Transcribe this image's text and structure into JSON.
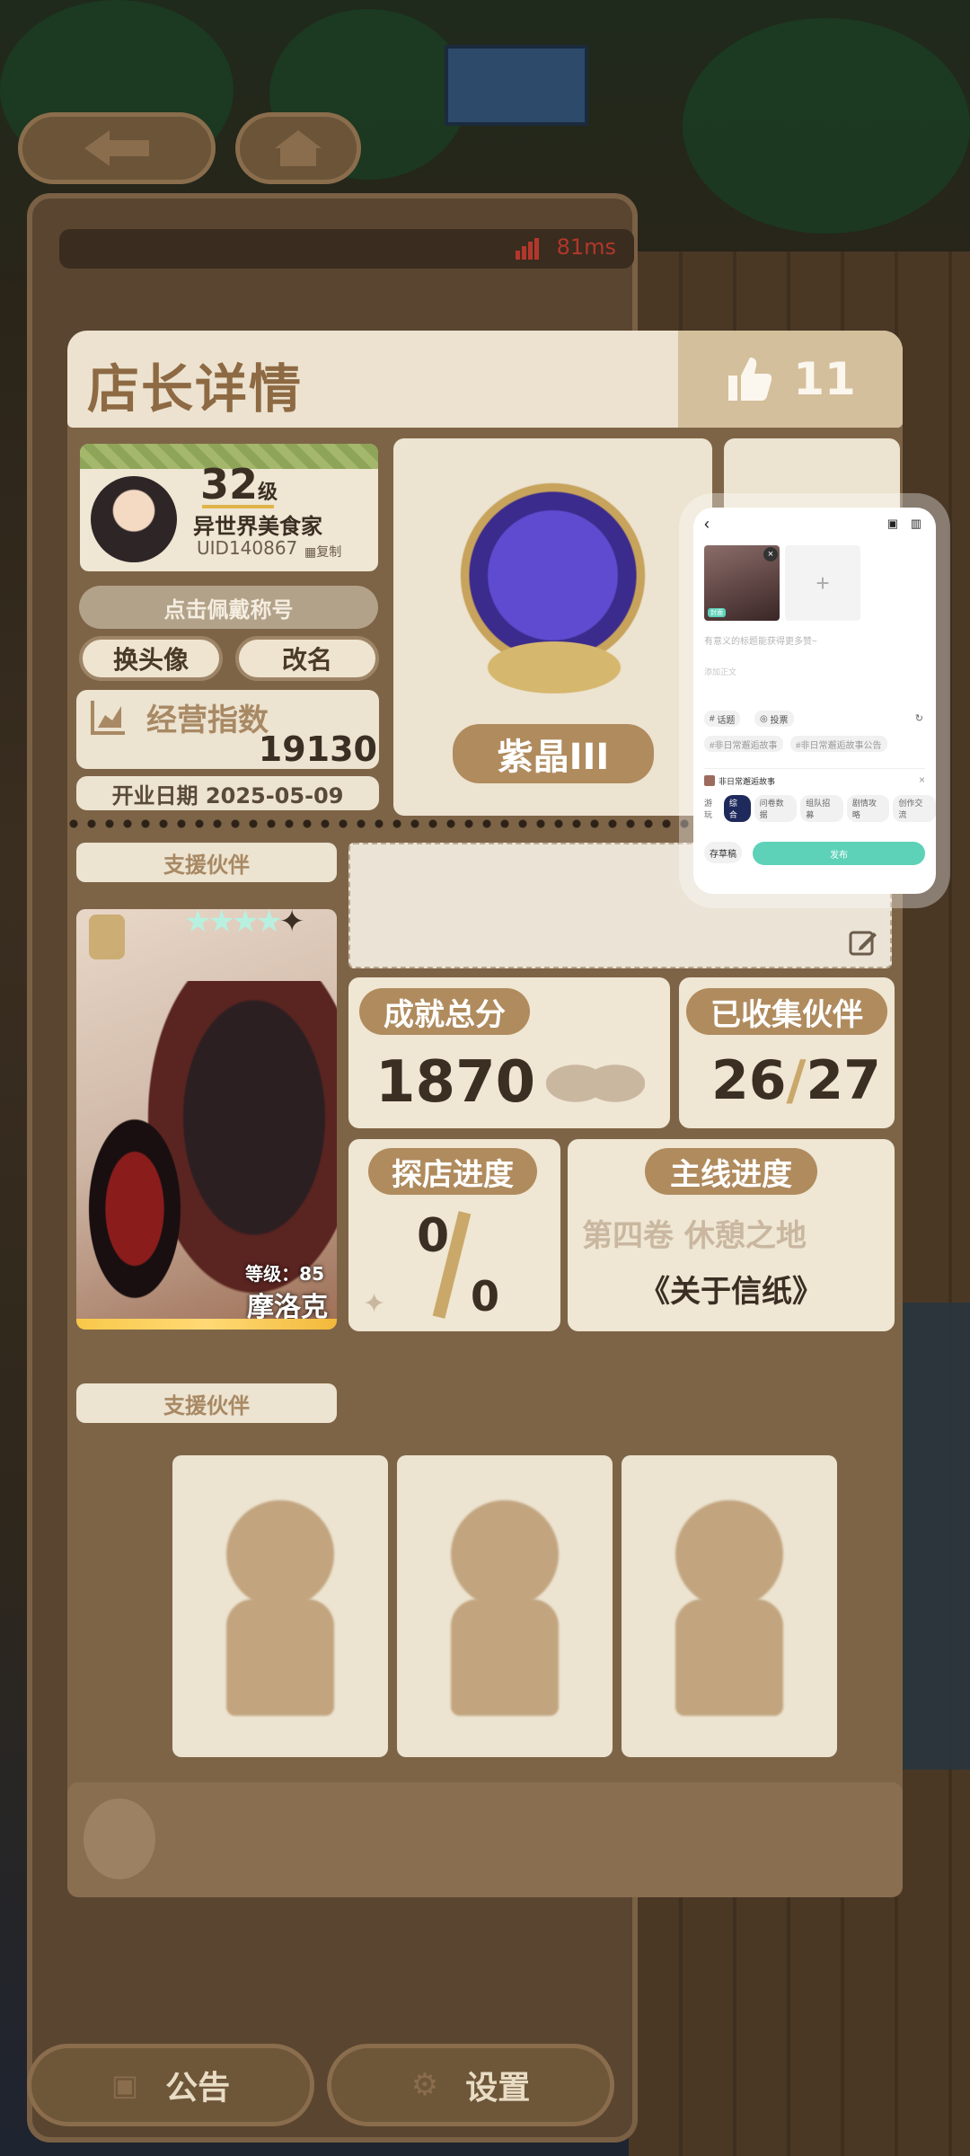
{
  "header": {
    "title": "店长详情",
    "likes": "11"
  },
  "hud": {
    "latency": "81ms"
  },
  "profile": {
    "level": "32",
    "level_unit": "级",
    "nickname": "异世界美食家",
    "uid": "UID140867",
    "copy_label": "复制",
    "wear_title_label": "点击佩戴称号",
    "change_avatar_label": "换头像",
    "rename_label": "改名",
    "score_label": "经营指数",
    "score_value": "19130",
    "open_date": "开业日期 2025-05-09"
  },
  "rank": {
    "name": "紫晶III"
  },
  "support": {
    "label": "支援伙伴",
    "partner": {
      "level_text": "等级：85",
      "name": "摩洛克",
      "stars": 5
    }
  },
  "stats": {
    "achievement_label": "成就总分",
    "achievement_value": "1870",
    "collected_label": "已收集伙伴",
    "collected_current": "26",
    "collected_sep": "/",
    "collected_total": "27",
    "explore_label": "探店进度",
    "explore_current": "0",
    "explore_total": "0",
    "main_label": "主线进度",
    "main_chapter": "第四卷 休憩之地",
    "main_episode": "《关于信纸》"
  },
  "support2": {
    "label": "支援伙伴"
  },
  "footer": {
    "notice_label": "公告",
    "settings_label": "设置"
  },
  "overlay": {
    "title_placeholder": "有意义的标题能获得更多赞~",
    "body_placeholder": "添加正文",
    "topic_label": "话题",
    "vote_label": "投票",
    "tags": [
      "#非日常邂逅故事",
      "#非日常邂逅故事公告"
    ],
    "forum_name": "非日常邂逅故事",
    "category_prefix": "游玩",
    "categories": [
      "综合",
      "问卷数据",
      "组队招募",
      "剧情攻略",
      "创作交流"
    ],
    "draft_label": "存草稿",
    "publish_label": "发布",
    "image_badge": "封面",
    "add_symbol": "+"
  }
}
